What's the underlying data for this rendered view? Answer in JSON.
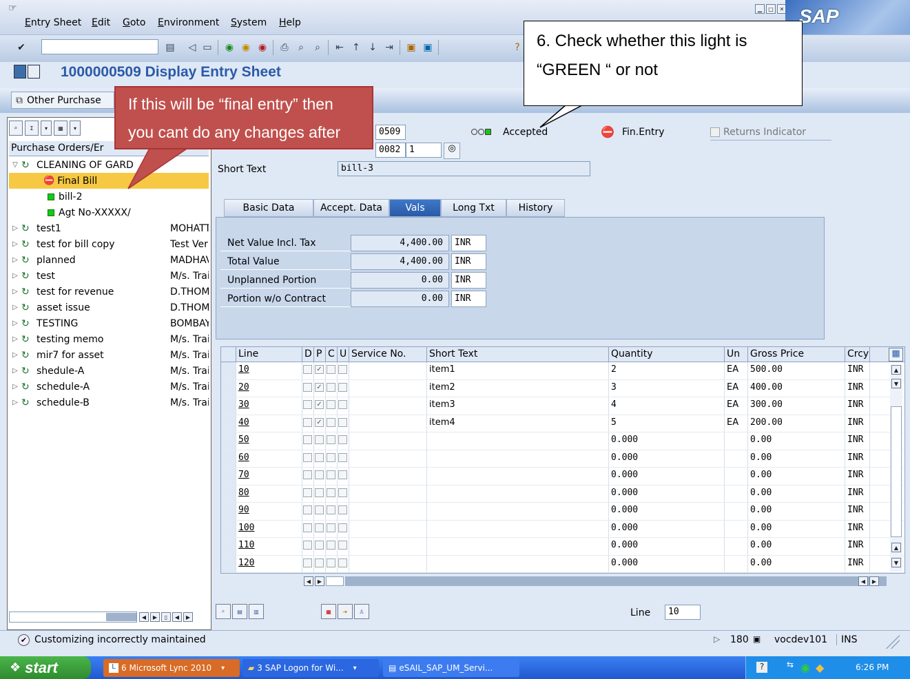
{
  "menu": {
    "items": [
      "Entry Sheet",
      "Edit",
      "Goto",
      "Environment",
      "System",
      "Help"
    ],
    "logo": "SAP"
  },
  "toolbar": {
    "command_value": "",
    "icons": [
      "enter-icon",
      "save-icon",
      "back-icon",
      "exit-icon",
      "cancel-icon",
      "print-icon",
      "find-icon",
      "help-icon"
    ]
  },
  "title": {
    "text": "1000000509 Display Entry Sheet"
  },
  "appbar": {
    "other_purchase_label": "Other Purchase"
  },
  "header": {
    "entry_sheet_no": "0509",
    "po_number": "0082",
    "po_item": "1",
    "status_label": "Accepted",
    "fin_entry_label": "Fin.Entry",
    "returns_indicator_label": "Returns Indicator",
    "short_text_label": "Short Text",
    "short_text_value": "bill-3"
  },
  "tree": {
    "header": "Purchase Orders/Er",
    "nodes": [
      {
        "label": "CLEANING OF GARD",
        "col2": "",
        "level": 0,
        "expanded": true,
        "type": "folder"
      },
      {
        "label": "Final Bill",
        "col2": "",
        "level": 1,
        "type": "final",
        "selected": true
      },
      {
        "label": "bill-2",
        "col2": "",
        "level": 1,
        "type": "green"
      },
      {
        "label": "Agt No-XXXXX/",
        "col2": "",
        "level": 1,
        "type": "green"
      },
      {
        "label": "test1",
        "col2": "MOHATT",
        "level": 0,
        "type": "folder"
      },
      {
        "label": "test for bill copy",
        "col2": "Test Ver",
        "level": 0,
        "type": "folder"
      },
      {
        "label": "planned",
        "col2": "MADHAV",
        "level": 0,
        "type": "folder"
      },
      {
        "label": "test",
        "col2": "M/s. Trai",
        "level": 0,
        "type": "folder"
      },
      {
        "label": "test for revenue",
        "col2": "D.THOM",
        "level": 0,
        "type": "folder"
      },
      {
        "label": "asset issue",
        "col2": "D.THOM",
        "level": 0,
        "type": "folder"
      },
      {
        "label": "TESTING",
        "col2": "BOMBAY",
        "level": 0,
        "type": "folder"
      },
      {
        "label": "testing memo",
        "col2": "M/s. Trai",
        "level": 0,
        "type": "folder"
      },
      {
        "label": "mir7 for asset",
        "col2": "M/s. Trai",
        "level": 0,
        "type": "folder"
      },
      {
        "label": "shedule-A",
        "col2": "M/s. Trai",
        "level": 0,
        "type": "folder"
      },
      {
        "label": "schedule-A",
        "col2": "M/s. Trai",
        "level": 0,
        "type": "folder"
      },
      {
        "label": "schedule-B",
        "col2": "M/s. Trai",
        "level": 0,
        "type": "folder"
      }
    ]
  },
  "tabs": [
    "Basic Data",
    "Accept. Data",
    "Vals",
    "Long Txt",
    "History"
  ],
  "active_tab": "Vals",
  "vals": [
    {
      "label": "Net Value Incl. Tax",
      "value": "4,400.00",
      "currency": "INR"
    },
    {
      "label": "Total Value",
      "value": "4,400.00",
      "currency": "INR"
    },
    {
      "label": "Unplanned Portion",
      "value": "0.00",
      "currency": "INR"
    },
    {
      "label": "Portion w/o Contract",
      "value": "0.00",
      "currency": "INR"
    }
  ],
  "grid": {
    "columns": [
      "Line",
      "D",
      "P",
      "C",
      "U",
      "Service No.",
      "Short Text",
      "Quantity",
      "Un",
      "Gross Price",
      "Crcy"
    ],
    "rows": [
      {
        "line": "10",
        "d": false,
        "p": true,
        "c": false,
        "u": false,
        "service": "",
        "text": "item1",
        "qty": "2",
        "un": "EA",
        "price": "500.00",
        "crcy": "INR"
      },
      {
        "line": "20",
        "d": false,
        "p": true,
        "c": false,
        "u": false,
        "service": "",
        "text": "item2",
        "qty": "3",
        "un": "EA",
        "price": "400.00",
        "crcy": "INR"
      },
      {
        "line": "30",
        "d": false,
        "p": true,
        "c": false,
        "u": false,
        "service": "",
        "text": "item3",
        "qty": "4",
        "un": "EA",
        "price": "300.00",
        "crcy": "INR"
      },
      {
        "line": "40",
        "d": false,
        "p": true,
        "c": false,
        "u": false,
        "service": "",
        "text": "item4",
        "qty": "5",
        "un": "EA",
        "price": "200.00",
        "crcy": "INR"
      },
      {
        "line": "50",
        "d": false,
        "p": false,
        "c": false,
        "u": false,
        "service": "",
        "text": "",
        "qty": "0.000",
        "un": "",
        "price": "0.00",
        "crcy": "INR"
      },
      {
        "line": "60",
        "d": false,
        "p": false,
        "c": false,
        "u": false,
        "service": "",
        "text": "",
        "qty": "0.000",
        "un": "",
        "price": "0.00",
        "crcy": "INR"
      },
      {
        "line": "70",
        "d": false,
        "p": false,
        "c": false,
        "u": false,
        "service": "",
        "text": "",
        "qty": "0.000",
        "un": "",
        "price": "0.00",
        "crcy": "INR"
      },
      {
        "line": "80",
        "d": false,
        "p": false,
        "c": false,
        "u": false,
        "service": "",
        "text": "",
        "qty": "0.000",
        "un": "",
        "price": "0.00",
        "crcy": "INR"
      },
      {
        "line": "90",
        "d": false,
        "p": false,
        "c": false,
        "u": false,
        "service": "",
        "text": "",
        "qty": "0.000",
        "un": "",
        "price": "0.00",
        "crcy": "INR"
      },
      {
        "line": "100",
        "d": false,
        "p": false,
        "c": false,
        "u": false,
        "service": "",
        "text": "",
        "qty": "0.000",
        "un": "",
        "price": "0.00",
        "crcy": "INR"
      },
      {
        "line": "110",
        "d": false,
        "p": false,
        "c": false,
        "u": false,
        "service": "",
        "text": "",
        "qty": "0.000",
        "un": "",
        "price": "0.00",
        "crcy": "INR"
      },
      {
        "line": "120",
        "d": false,
        "p": false,
        "c": false,
        "u": false,
        "service": "",
        "text": "",
        "qty": "0.000",
        "un": "",
        "price": "0.00",
        "crcy": "INR"
      }
    ]
  },
  "line_field": {
    "label": "Line",
    "value": "10"
  },
  "status": {
    "message": "Customizing incorrectly maintained",
    "session": "180",
    "server": "vocdev101",
    "mode": "INS"
  },
  "callouts": {
    "light_check": "6. Check whether this light is “GREEN “ or not",
    "final_entry": "If this will be “final entry” then you cant do any changes after saving"
  },
  "taskbar": {
    "start": "start",
    "tasks": [
      "6 Microsoft Lync 2010",
      "3 SAP Logon for Wi...",
      "eSAIL_SAP_UM_Servi..."
    ],
    "clock": "6:26 PM"
  },
  "colors": {
    "accent": "#2a5aa8",
    "status_green": "#19c619",
    "callout_red": "#c0504d"
  }
}
